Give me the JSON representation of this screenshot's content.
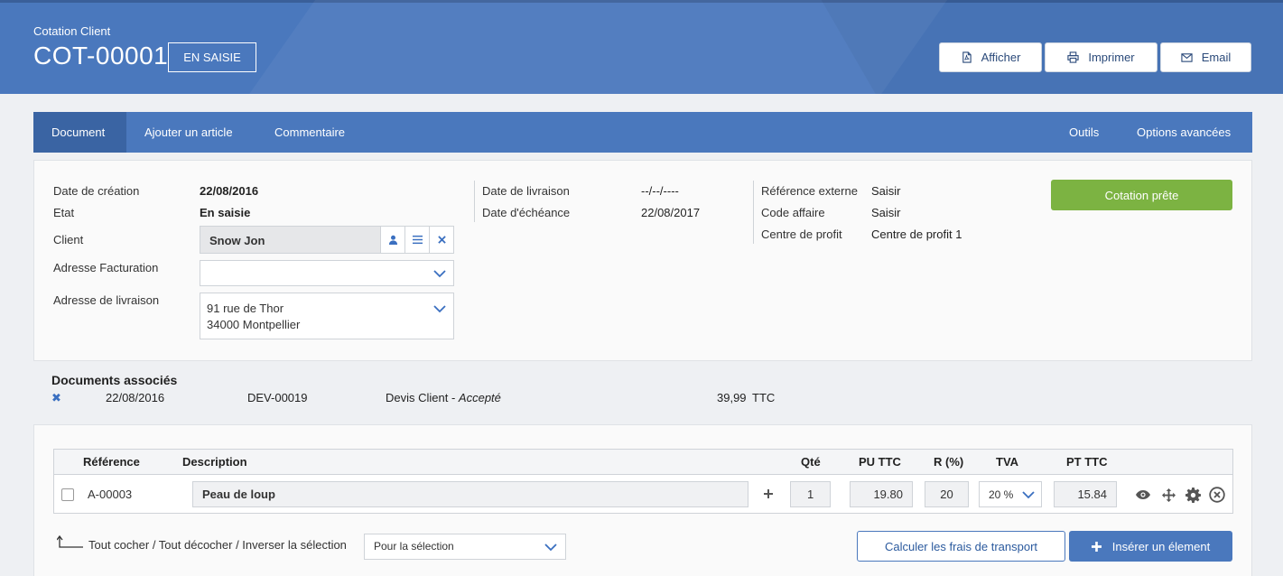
{
  "header": {
    "subtitle": "Cotation Client",
    "title": "COT-00001",
    "status": "EN SAISIE",
    "actions": {
      "show": "Afficher",
      "print": "Imprimer",
      "email": "Email"
    }
  },
  "tabs": {
    "document": "Document",
    "add_article": "Ajouter un article",
    "comment": "Commentaire",
    "tools": "Outils",
    "advanced": "Options avancées"
  },
  "document": {
    "creation_date_label": "Date de création",
    "creation_date": "22/08/2016",
    "state_label": "Etat",
    "state": "En saisie",
    "client_label": "Client",
    "client": "Snow Jon",
    "billing_label": "Adresse Facturation",
    "billing_value": "",
    "delivery_addr_label": "Adresse de livraison",
    "delivery_addr_line1": "91 rue de Thor",
    "delivery_addr_line2": "34000 Montpellier",
    "delivery_date_label": "Date de livraison",
    "delivery_date": "--/--/----",
    "due_date_label": "Date d'échéance",
    "due_date": "22/08/2017",
    "ext_ref_label": "Référence externe",
    "ext_ref": "Saisir",
    "business_code_label": "Code affaire",
    "business_code": "Saisir",
    "profit_center_label": "Centre de profit",
    "profit_center": "Centre de profit 1",
    "ready_button": "Cotation prête"
  },
  "associated": {
    "title": "Documents associés",
    "items": [
      {
        "date": "22/08/2016",
        "number": "DEV-00019",
        "type": "Devis Client - ",
        "status": "Accepté",
        "amount": "39,99",
        "unit": "TTC"
      }
    ]
  },
  "table": {
    "headers": {
      "reference": "Référence",
      "description": "Description",
      "qty": "Qté",
      "pu": "PU TTC",
      "discount": "R (%)",
      "tva": "TVA",
      "pt": "PT TTC"
    },
    "rows": [
      {
        "reference": "A-00003",
        "description": "Peau de loup",
        "qty": "1",
        "pu": "19.80",
        "discount": "20",
        "tva": "20 %",
        "pt": "15.84"
      }
    ]
  },
  "footer": {
    "selection_text": "Tout cocher / Tout décocher / Inverser la sélection",
    "bulk_select": "Pour la sélection",
    "shipping_button": "Calculer les frais de transport",
    "insert_button": "Insérer un élement"
  },
  "icons": [
    "pdf-icon",
    "print-icon",
    "email-icon",
    "user-icon",
    "list-icon",
    "remove-icon",
    "chevron-down-icon",
    "plus-icon",
    "eye-icon",
    "move-icon",
    "gear-icon",
    "circle-close-icon"
  ],
  "colors": {
    "primary": "#4a78bd",
    "tab_active": "#3a64a3",
    "success": "#7cb342",
    "link": "#3a6fc0"
  }
}
